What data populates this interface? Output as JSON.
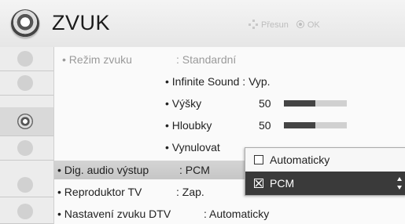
{
  "header": {
    "title": "ZVUK",
    "hint_move": "Přesun",
    "hint_ok": "OK"
  },
  "sidebar": {
    "items": [
      {
        "icon": "picture-icon"
      },
      {
        "icon": "monitor-icon"
      },
      {
        "icon": "sound-icon",
        "active": true
      },
      {
        "icon": "clock-icon"
      },
      {
        "icon": "lock-icon"
      },
      {
        "icon": "option-icon"
      }
    ]
  },
  "menu": {
    "sound_mode": {
      "label": "• Režim zvuku",
      "value": ": Standardní"
    },
    "infinite_sound": {
      "label": "• Infinite Sound : Vyp."
    },
    "treble": {
      "label": "• Výšky",
      "value": "50",
      "level": 0.5
    },
    "bass": {
      "label": "• Hloubky",
      "value": "50",
      "level": 0.5
    },
    "reset": {
      "label": "• Vynulovat"
    },
    "digital_audio_out": {
      "label": "• Dig. audio výstup",
      "value": ": PCM"
    },
    "tv_speaker": {
      "label": "• Reproduktor TV",
      "value": ": Zap."
    },
    "dtv_sound": {
      "label": "• Nastavení zvuku DTV",
      "value": ": Automaticky"
    }
  },
  "popup": {
    "options": [
      {
        "label": "Automaticky",
        "checked": false
      },
      {
        "label": "PCM",
        "checked": true
      }
    ]
  },
  "colors": {
    "selected_bg": "#c8c8c8",
    "popup_selected_bg": "#3a3a3a",
    "bar_fill": "#444444"
  }
}
